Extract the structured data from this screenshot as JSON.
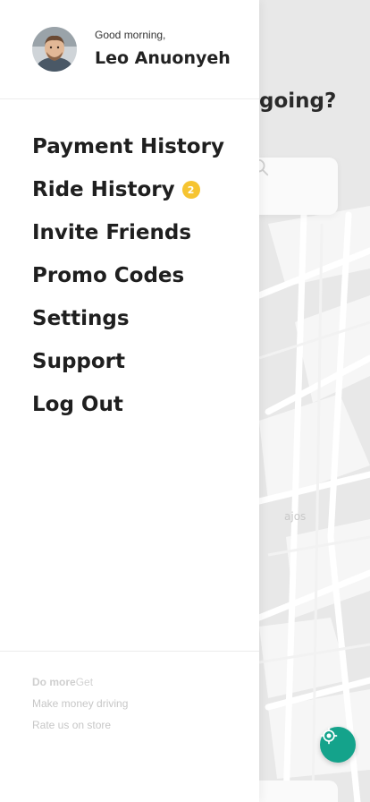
{
  "map": {
    "headline_fragment": "going?",
    "place_label": "ajos"
  },
  "search": {
    "icon": "search-icon"
  },
  "profile": {
    "greeting": "Good morning,",
    "name": "Leo Anuonyeh",
    "avatar_icon": "user-avatar"
  },
  "menu": {
    "items": [
      {
        "label": "Payment History"
      },
      {
        "label": "Ride History",
        "badge": "2"
      },
      {
        "label": "Invite Friends"
      },
      {
        "label": "Promo Codes"
      },
      {
        "label": "Settings"
      },
      {
        "label": "Support"
      },
      {
        "label": "Log Out"
      }
    ]
  },
  "footer": {
    "do_more": "Do more",
    "get": "Get",
    "make_money": "Make money driving",
    "rate_us": "Rate us on store"
  },
  "colors": {
    "accent": "#14a38b",
    "badge": "#f6c431"
  }
}
